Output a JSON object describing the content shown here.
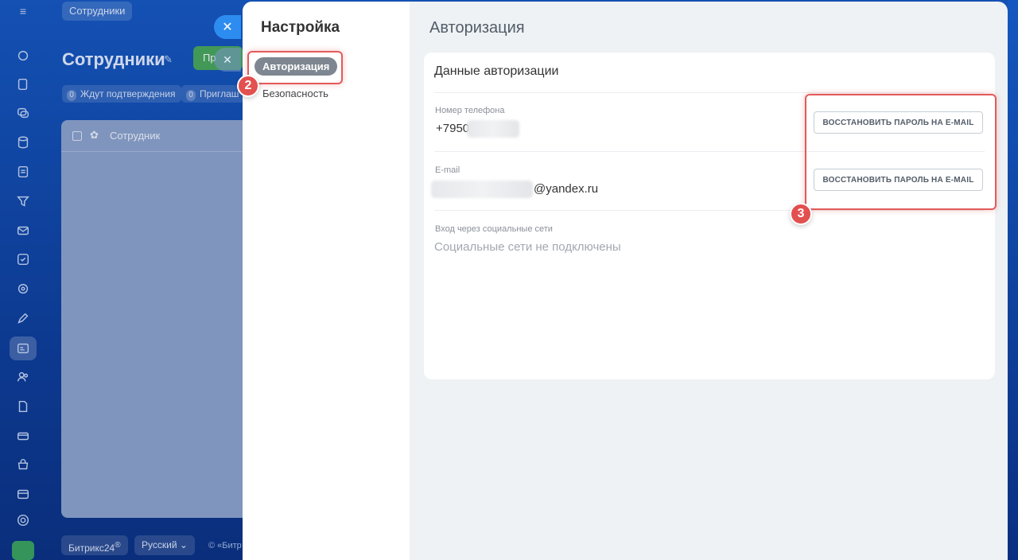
{
  "background": {
    "breadcrumb": "Сотрудники",
    "page_title": "Сотрудники",
    "green_button": "Пр",
    "filters": [
      {
        "count": "0",
        "label": "Ждут подтверждения"
      },
      {
        "count": "0",
        "label": "Приглаш"
      }
    ],
    "table_column": "Сотрудник",
    "footer": {
      "brand": "Битрикс24",
      "brand_mark": "®",
      "language": "Русский",
      "copyright": "© «Битр"
    }
  },
  "nav": {
    "title": "Настройка",
    "items": [
      {
        "label": "Авторизация",
        "active": true
      },
      {
        "label": "Безопасность",
        "active": false
      }
    ]
  },
  "main": {
    "section_title": "Авторизация",
    "card_title": "Данные авторизации",
    "phone": {
      "label": "Номер телефона",
      "value_visible": "+7950",
      "button": "ВОССТАНОВИТЬ ПАРОЛЬ НА E-MAIL"
    },
    "email": {
      "label": "E-mail",
      "value_visible": "@yandex.ru",
      "button": "ВОССТАНОВИТЬ ПАРОЛЬ НА E-MAIL"
    },
    "social": {
      "label": "Вход через социальные сети",
      "value": "Социальные сети не подключены"
    }
  },
  "annotations": {
    "step_2": "2",
    "step_3": "3",
    "highlight_color": "#e35a5a"
  },
  "colors": {
    "accent_blue": "#2d8cf0",
    "active_tab": "#7e8791",
    "panel_bg": "#eef2f4"
  }
}
